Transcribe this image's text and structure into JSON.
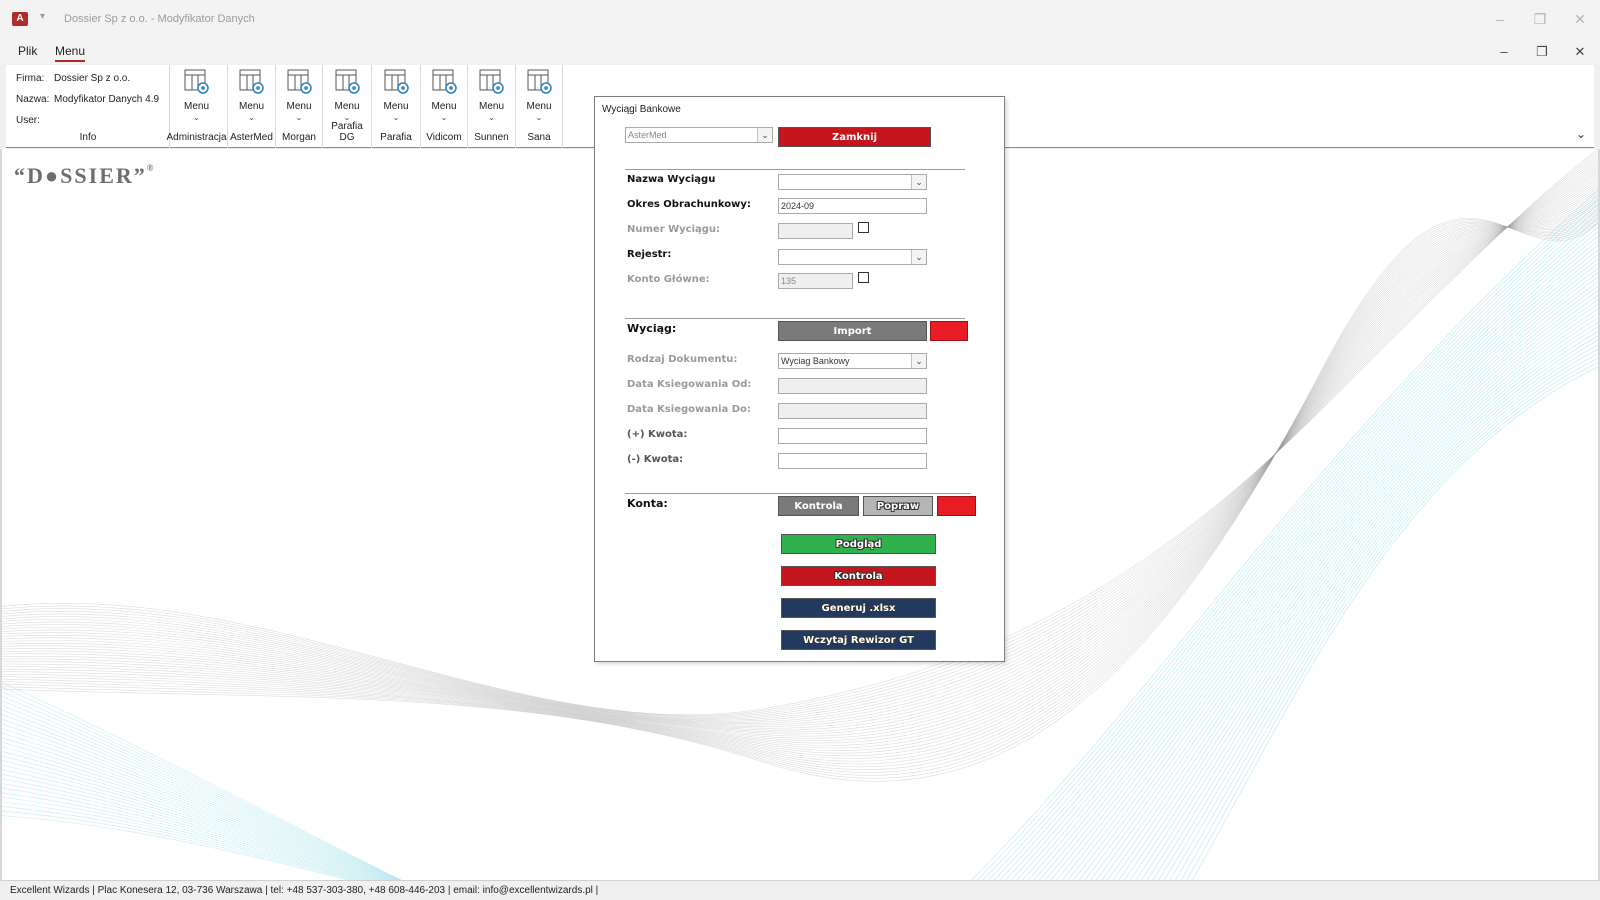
{
  "window": {
    "title": "Dossier Sp z o.o. - Modyfikator Danych",
    "app_icon": "access-icon",
    "app_icon_glyph": "A"
  },
  "menu": {
    "tabs": [
      "Plik",
      "Menu"
    ],
    "active_tab": "Menu"
  },
  "ribbon": {
    "info": {
      "firma_label": "Firma:",
      "firma_value": "Dossier Sp z o.o.",
      "nazwa_label": "Nazwa:",
      "nazwa_value": "Modyfikator Danych 4.9",
      "user_label": "User:",
      "user_value": "",
      "caption": "Info"
    },
    "groups": [
      {
        "button": "Menu",
        "caption": "Administracja"
      },
      {
        "button": "Menu",
        "caption": "AsterMed"
      },
      {
        "button": "Menu",
        "caption": "Morgan"
      },
      {
        "button": "Menu",
        "caption": "Parafia DG"
      },
      {
        "button": "Menu",
        "caption": "Parafia"
      },
      {
        "button": "Menu",
        "caption": "Vidicom"
      },
      {
        "button": "Menu",
        "caption": "Sunnen"
      },
      {
        "button": "Menu",
        "caption": "Sana"
      }
    ],
    "button_icon": "table-settings-icon"
  },
  "logo": {
    "text": "“D●SSIER”",
    "reg": "®"
  },
  "dialog": {
    "title": "Wyciągi Bankowe",
    "company_select": "AsterMed",
    "close_button": "Zamknij",
    "fields": {
      "nazwa_wyciagu_label": "Nazwa Wyciągu",
      "nazwa_wyciagu_value": "",
      "okres_label": "Okres Obrachunkowy:",
      "okres_value": "2024-09",
      "numer_label": "Numer Wyciągu:",
      "numer_value": "",
      "rejestr_label": "Rejestr:",
      "rejestr_value": "",
      "konto_label": "Konto Główne:",
      "konto_value": "135"
    },
    "wyciag_section": {
      "label": "Wyciąg:",
      "import_button": "Import",
      "rodzaj_label": "Rodzaj Dokumentu:",
      "rodzaj_value": "Wyciag Bankowy",
      "data_od_label": "Data Ksiegowania Od:",
      "data_od_value": "",
      "data_do_label": "Data Ksiegowania Do:",
      "data_do_value": "",
      "kwota_plus_label": "(+) Kwota:",
      "kwota_plus_value": "",
      "kwota_minus_label": "(-) Kwota:",
      "kwota_minus_value": ""
    },
    "konta_section": {
      "label": "Konta:",
      "kontrola_button": "Kontrola",
      "popraw_button": "Popraw"
    },
    "actions": {
      "podglad": "Podgląd",
      "kontrola": "Kontrola",
      "generuj": "Generuj .xlsx",
      "wczytaj": "Wczytaj Rewizor GT"
    }
  },
  "status_bar": {
    "text": "Excellent Wizards | Plac Konesera 12, 03-736 Warszawa | tel: +48 537-303-380, +48 608-446-203 | email: info@excellentwizards.pl |"
  },
  "colors": {
    "red": "#c4161c",
    "bright_red": "#e81c24",
    "gray_button": "#7a7a7a",
    "green": "#2fb24c",
    "navy": "#223a5e",
    "teal_wave": "#4fc6d4"
  }
}
